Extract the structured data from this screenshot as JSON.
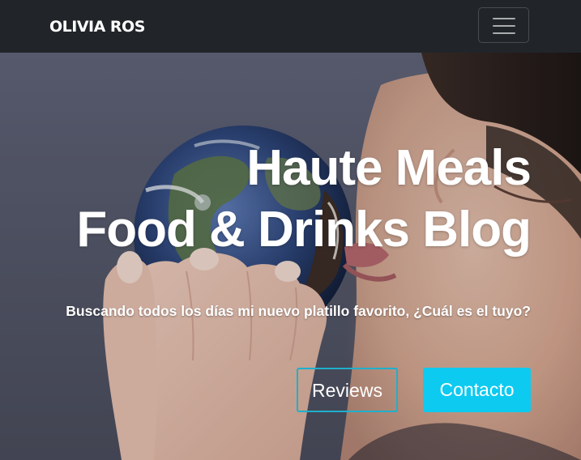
{
  "navbar": {
    "brand": "OLIVIA ROS",
    "toggle_icon": "hamburger-menu-icon"
  },
  "hero": {
    "title_line1": "Haute Meals",
    "title_line2": "Food & Drinks Blog",
    "subtitle": "Buscando todos los días mi nuevo platillo favorito, ¿Cuál es el tuyo?",
    "buttons": {
      "reviews_label": "Reviews",
      "contacto_label": "Contacto"
    },
    "background_image": "woman-biting-earth-globe-photo"
  },
  "colors": {
    "navbar_bg": "#212529",
    "accent": "#0dcaf0",
    "outline_border": "#1fb0cc",
    "text": "#ffffff"
  }
}
